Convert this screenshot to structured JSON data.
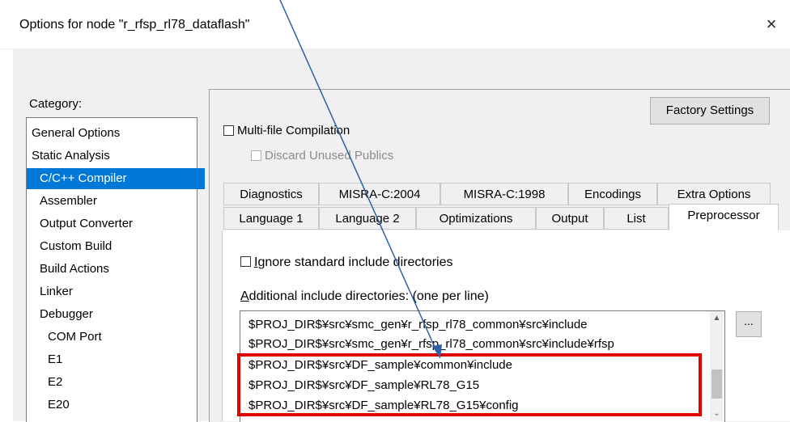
{
  "window": {
    "title": "Options for node \"r_rfsp_rl78_dataflash\"",
    "close_label": "×"
  },
  "category": {
    "label": "Category:",
    "items": [
      "General Options",
      "Static Analysis",
      "C/C++ Compiler",
      "Assembler",
      "Output Converter",
      "Custom Build",
      "Build Actions",
      "Linker",
      "Debugger",
      "COM Port",
      "E1",
      "E2",
      "E20"
    ],
    "selected": "C/C++ Compiler"
  },
  "factory_settings_label": "Factory Settings",
  "multi_file_compilation": {
    "label": "Multi-file Compilation",
    "checked": false
  },
  "discard_unused_publics": {
    "label": "Discard Unused Publics",
    "checked": false,
    "disabled": true
  },
  "tabs_row1": [
    "Diagnostics",
    "MISRA-C:2004",
    "MISRA-C:1998",
    "Encodings",
    "Extra Options"
  ],
  "tabs_row2": [
    "Language 1",
    "Language 2",
    "Optimizations",
    "Output",
    "List",
    "Preprocessor"
  ],
  "active_tab": "Preprocessor",
  "preprocessor": {
    "ignore_std_label_pre": "",
    "ignore_std_label_u": "I",
    "ignore_std_label_post": "gnore standard include directories",
    "additional_label_u": "A",
    "additional_label_post": "dditional include directories: (one per line)",
    "directories": [
      "$PROJ_DIR$¥src¥smc_gen¥r_rfsp_rl78_common¥src¥include",
      "$PROJ_DIR$¥src¥smc_gen¥r_rfsp_rl78_common¥src¥include¥rfsp",
      "$PROJ_DIR$¥src¥DF_sample¥common¥include",
      "$PROJ_DIR$¥src¥DF_sample¥RL78_G15",
      "$PROJ_DIR$¥src¥DF_sample¥RL78_G15¥config"
    ],
    "browse_label": "...",
    "highlight_color": "#e00000"
  },
  "colors": {
    "selection": "#0078d7",
    "arrow": "#2e5fa8"
  }
}
